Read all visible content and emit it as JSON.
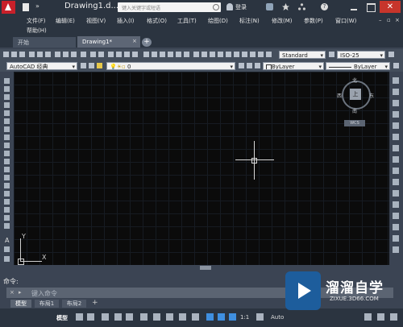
{
  "title_bar": {
    "doc_title": "Drawing1.d...",
    "search_placeholder": "键入关键字或短语",
    "login": "登录"
  },
  "menu": [
    "文件(F)",
    "编辑(E)",
    "视图(V)",
    "插入(I)",
    "格式(O)",
    "工具(T)",
    "绘图(D)",
    "标注(N)",
    "修改(M)",
    "参数(P)",
    "窗口(W)",
    "帮助(H)"
  ],
  "tabs": {
    "start": "开始",
    "drawing": "Drawing1*",
    "plus": "+"
  },
  "toolbar": {
    "text_style": "Standard",
    "dim_style": "ISO-25",
    "workspace": "AutoCAD 经典",
    "layer": "0",
    "color": "ByLayer",
    "linetype": "ByLayer"
  },
  "viewcube": {
    "north": "北",
    "south": "南",
    "east": "东",
    "west": "西",
    "top": "上",
    "wcs": "WCS"
  },
  "ucs": {
    "x": "X",
    "y": "Y"
  },
  "command": {
    "label": "命令:",
    "placeholder": "键入命令"
  },
  "layout_tabs": [
    "模型",
    "布局1",
    "布局2"
  ],
  "status": {
    "model": "模型",
    "scale": "1:1",
    "ws": "Auto"
  },
  "watermark": {
    "name": "溜溜自学",
    "site": "ZIXUE.3D66.COM"
  },
  "colors": {
    "canvas": "#0b0b0b",
    "chrome": "#2b3440",
    "close": "#c7352b",
    "watermark": "#1d5d9c"
  }
}
